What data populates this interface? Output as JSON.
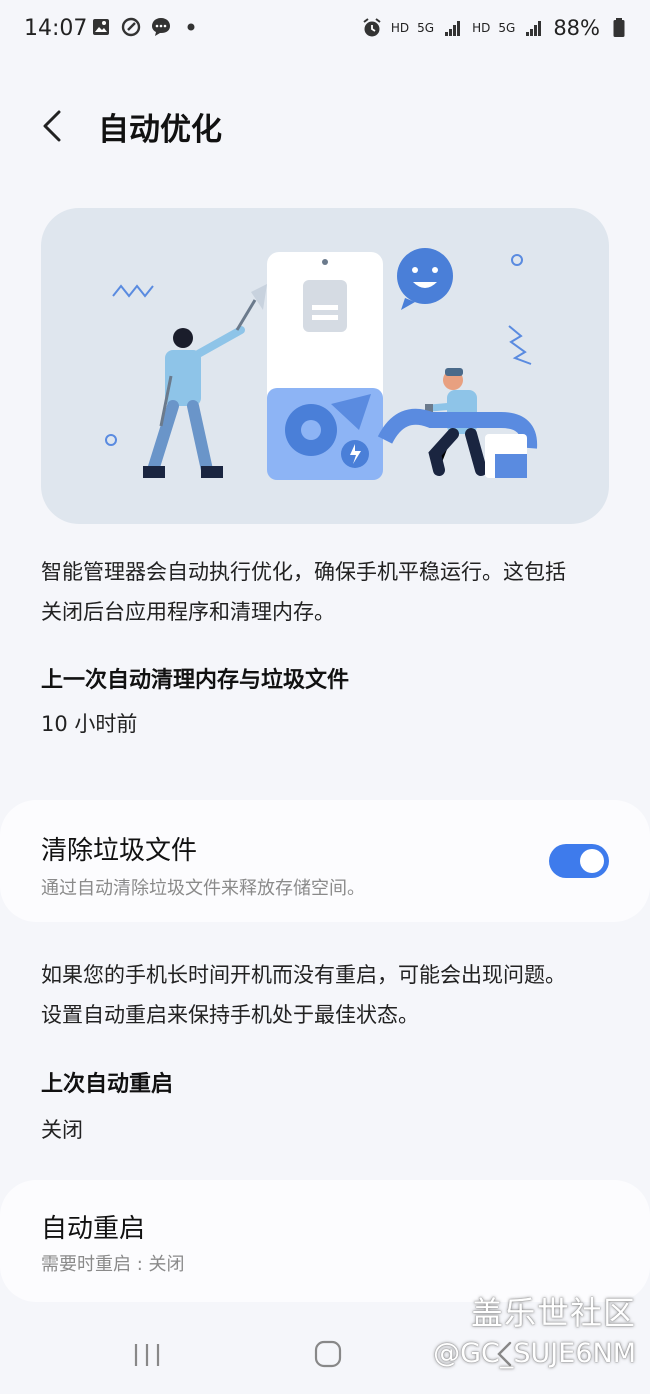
{
  "status_bar": {
    "time": "14:07",
    "left_icons": [
      "gallery-icon",
      "sync-icon",
      "chat-icon",
      "dot-icon"
    ],
    "right_icons": [
      "alarm-icon",
      "hd-label",
      "5g-icon",
      "signal-icon",
      "hd-label",
      "5g-signal-icon",
      "battery-icon"
    ],
    "hd1": "HD",
    "fiveg1": "5G",
    "hd2": "HD",
    "fiveg2": "5G",
    "battery": "88%"
  },
  "header": {
    "title": "自动优化"
  },
  "intro": {
    "text_line1": "智能管理器会自动执行优化，确保手机平稳运行。这包括",
    "text_line2": "关闭后台应用程序和清理内存。"
  },
  "last_clean": {
    "title": "上一次自动清理内存与垃圾文件",
    "value": "10 小时前"
  },
  "clear_junk": {
    "title": "清除垃圾文件",
    "subtitle": "通过自动清除垃圾文件来释放存储空间。",
    "enabled": true
  },
  "restart_info": {
    "text_line1": "如果您的手机长时间开机而没有重启，可能会出现问题。",
    "text_line2": "设置自动重启来保持手机处于最佳状态。"
  },
  "last_restart": {
    "title": "上次自动重启",
    "value": "关闭"
  },
  "auto_restart": {
    "title": "自动重启",
    "subtitle": "需要时重启 : 关闭"
  },
  "bottom_nav": {
    "icons": [
      "recent-apps-icon",
      "home-icon",
      "back-icon"
    ]
  },
  "watermark": {
    "brand": "盖乐世社区",
    "user": "@GC_SUJE6NM"
  },
  "colors": {
    "accent": "#3e7bec",
    "hero_bg": "#dfe6ee",
    "background": "#f5f6fa"
  }
}
